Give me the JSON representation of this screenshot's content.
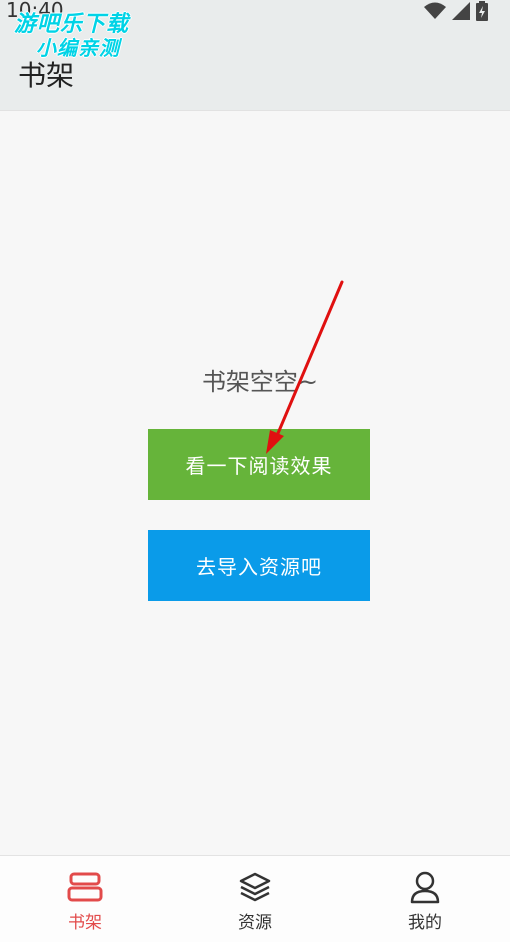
{
  "status_bar": {
    "time": "10:40"
  },
  "watermark": {
    "line1": "游吧乐下载",
    "line2": "小编亲测"
  },
  "app_bar": {
    "title": "书架"
  },
  "shelf": {
    "empty_text": "书架空空~",
    "preview_button": "看一下阅读效果",
    "import_button": "去导入资源吧"
  },
  "bottom_nav": {
    "items": [
      {
        "label": "书架",
        "icon": "bookshelf-icon",
        "active": true
      },
      {
        "label": "资源",
        "icon": "layers-icon",
        "active": false
      },
      {
        "label": "我的",
        "icon": "person-icon",
        "active": false
      }
    ]
  },
  "colors": {
    "accent_red": "#e24a4a",
    "green_button": "#66b43a",
    "blue_button": "#0a9be9",
    "annotation_arrow": "#e01010"
  }
}
